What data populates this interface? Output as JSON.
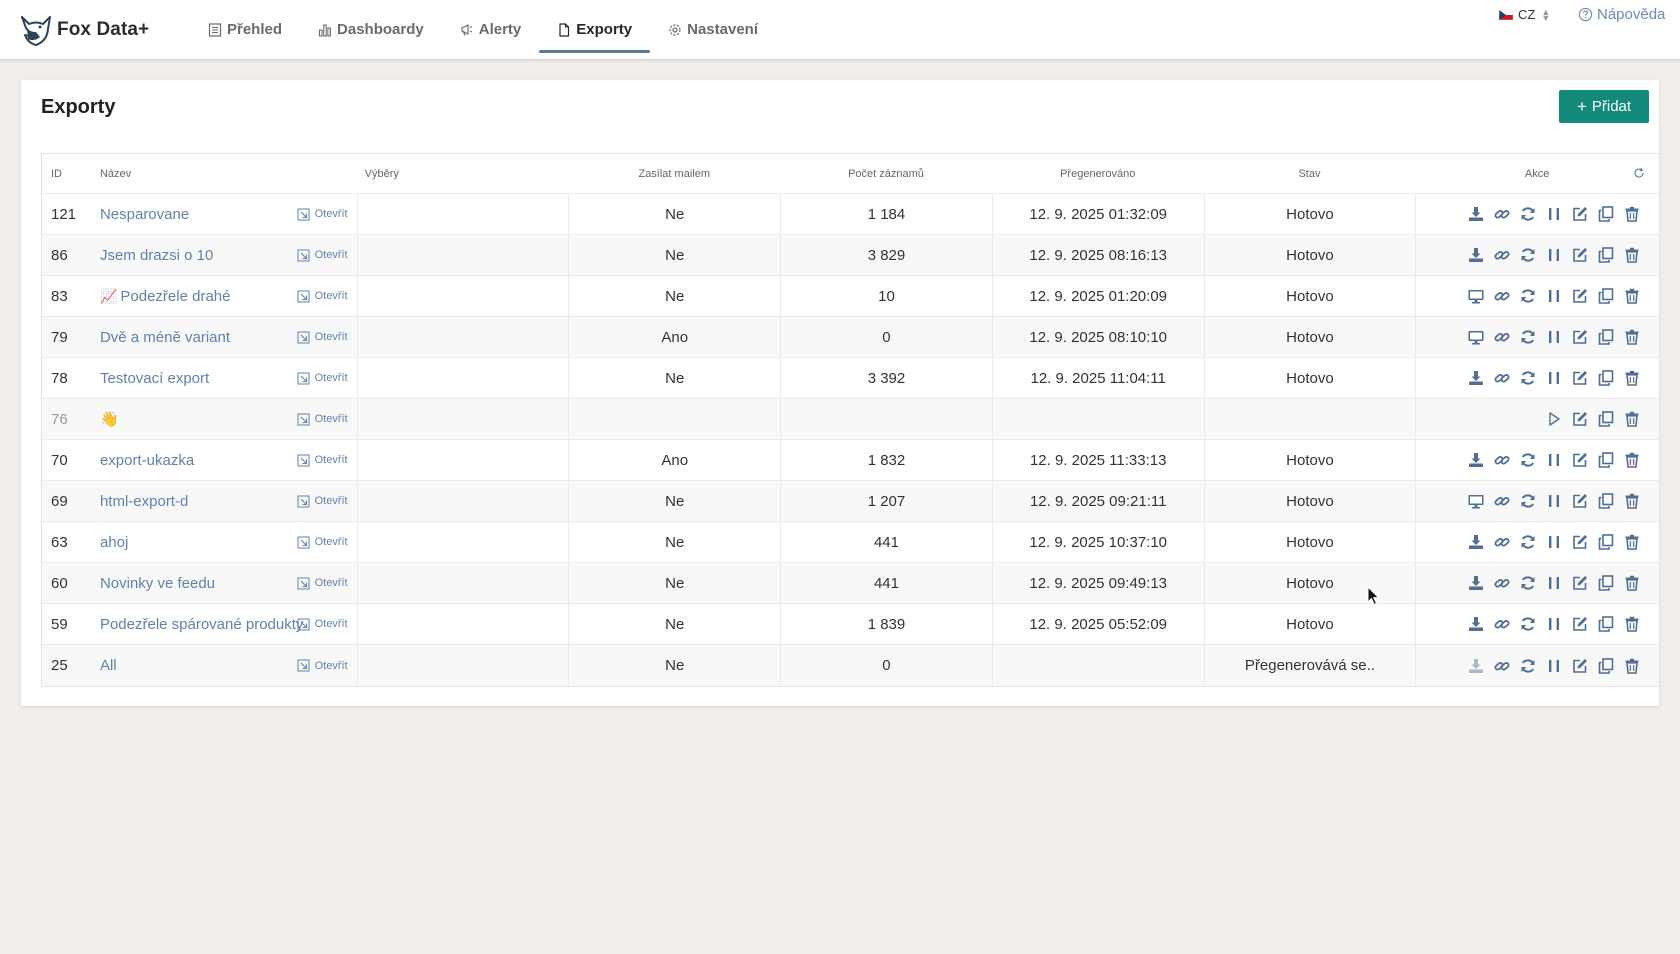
{
  "header": {
    "brand": "Fox Data+",
    "nav": [
      {
        "label": "Přehled",
        "icon": "list-icon",
        "active": false
      },
      {
        "label": "Dashboardy",
        "icon": "bar-chart-icon",
        "active": false
      },
      {
        "label": "Alerty",
        "icon": "megaphone-icon",
        "active": false
      },
      {
        "label": "Exporty",
        "icon": "file-icon",
        "active": true
      },
      {
        "label": "Nastavení",
        "icon": "gear-icon",
        "active": false
      }
    ],
    "language": "CZ",
    "help": "Nápověda"
  },
  "page": {
    "title": "Exporty",
    "add_button": "Přidat"
  },
  "table": {
    "columns": {
      "id": "ID",
      "name": "Název",
      "selections": "Výběry",
      "mail": "Zasílat mailem",
      "count": "Počet záznamů",
      "regenerated": "Přegenerováno",
      "state": "Stav",
      "actions": "Akce"
    },
    "open_label": "Otevřít",
    "rows": [
      {
        "id": "121",
        "name": "Nesparovane",
        "mail": "Ne",
        "count": "1 184",
        "regenerated": "12. 9. 2025 01:32:09",
        "state": "Hotovo",
        "primary_icon": "download"
      },
      {
        "id": "86",
        "name": "Jsem drazsi o 10",
        "mail": "Ne",
        "count": "3 829",
        "regenerated": "12. 9. 2025 08:16:13",
        "state": "Hotovo",
        "primary_icon": "download"
      },
      {
        "id": "83",
        "name": "Podezřele drahé",
        "emoji": "📈",
        "mail": "Ne",
        "count": "10",
        "regenerated": "12. 9. 2025 01:20:09",
        "state": "Hotovo",
        "primary_icon": "monitor"
      },
      {
        "id": "79",
        "name": "Dvě a méně variant",
        "mail": "Ano",
        "count": "0",
        "regenerated": "12. 9. 2025 08:10:10",
        "state": "Hotovo",
        "primary_icon": "monitor"
      },
      {
        "id": "78",
        "name": "Testovací export",
        "mail": "Ne",
        "count": "3 392",
        "regenerated": "12. 9. 2025 11:04:11",
        "state": "Hotovo",
        "primary_icon": "download"
      },
      {
        "id": "76",
        "name": "👋",
        "mail": "",
        "count": "",
        "regenerated": "",
        "state": "",
        "primary_icon": "play",
        "inactive": true
      },
      {
        "id": "70",
        "name": "export-ukazka",
        "mail": "Ano",
        "count": "1 832",
        "regenerated": "12. 9. 2025 11:33:13",
        "state": "Hotovo",
        "primary_icon": "download"
      },
      {
        "id": "69",
        "name": "html-export-d",
        "mail": "Ne",
        "count": "1 207",
        "regenerated": "12. 9. 2025 09:21:11",
        "state": "Hotovo",
        "primary_icon": "monitor"
      },
      {
        "id": "63",
        "name": "ahoj",
        "mail": "Ne",
        "count": "441",
        "regenerated": "12. 9. 2025 10:37:10",
        "state": "Hotovo",
        "primary_icon": "download"
      },
      {
        "id": "60",
        "name": "Novinky ve feedu",
        "mail": "Ne",
        "count": "441",
        "regenerated": "12. 9. 2025 09:49:13",
        "state": "Hotovo",
        "primary_icon": "download"
      },
      {
        "id": "59",
        "name": "Podezřele spárované produkty",
        "mail": "Ne",
        "count": "1 839",
        "regenerated": "12. 9. 2025 05:52:09",
        "state": "Hotovo",
        "primary_icon": "download"
      },
      {
        "id": "25",
        "name": "All",
        "mail": "Ne",
        "count": "0",
        "regenerated": "",
        "state": "Přegenerovává se..",
        "primary_icon": "download",
        "primary_disabled": true
      }
    ]
  },
  "colors": {
    "accent_button": "#138a7b",
    "link": "#5f82ad",
    "icon": "#4f6f95",
    "active_tab_underline": "#5a7a9a",
    "background": "#f1eee9"
  }
}
